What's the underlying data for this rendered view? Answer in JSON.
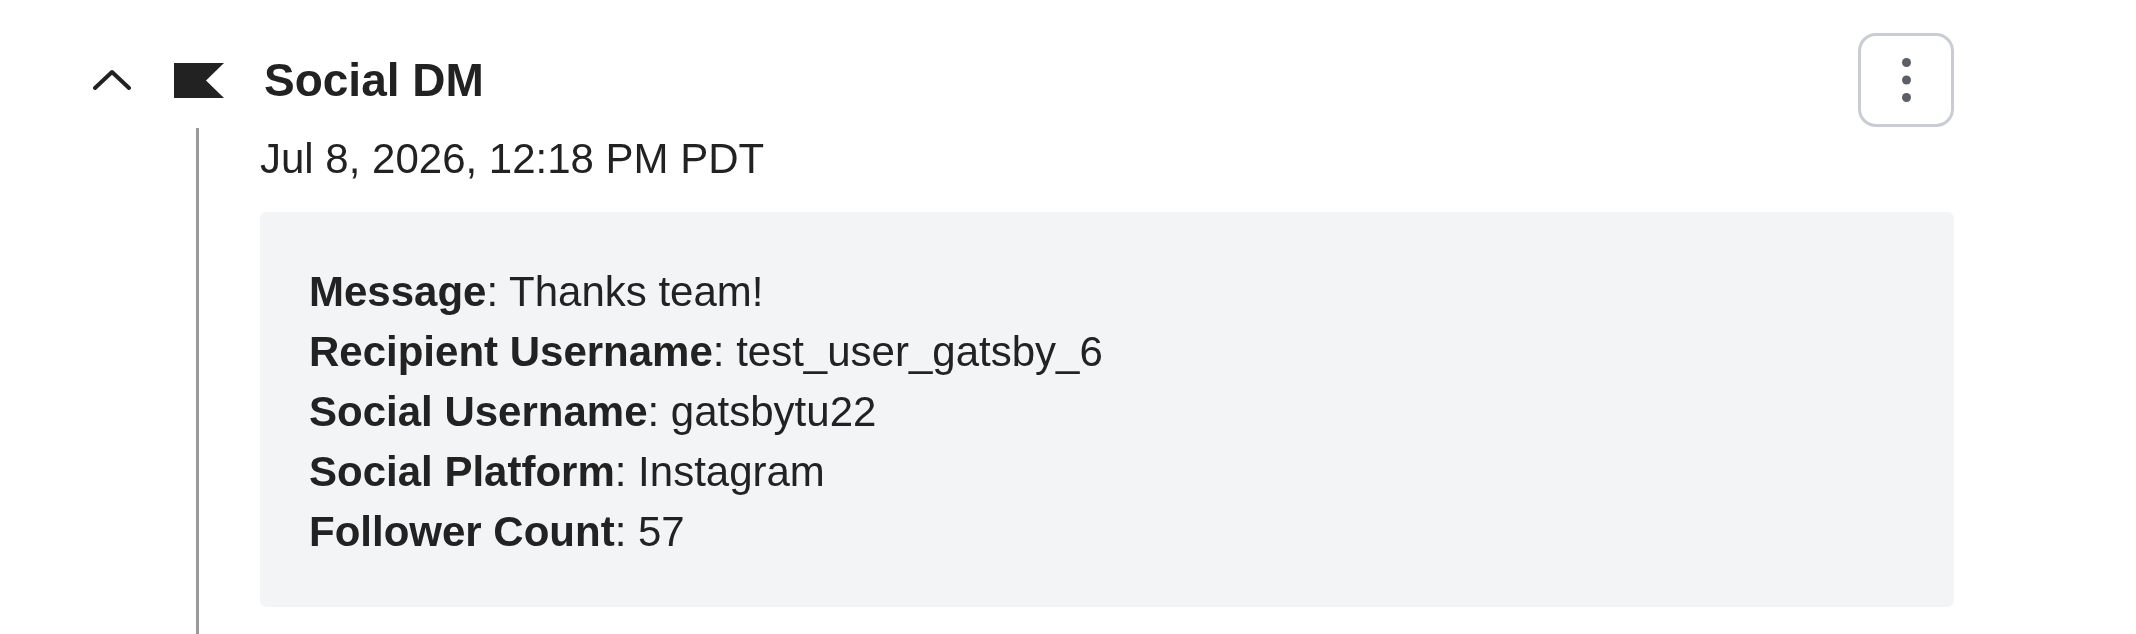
{
  "event": {
    "title": "Social DM",
    "expanded": true,
    "timestamp": "Jul 8, 2026, 12:18 PM PDT",
    "details": [
      "**Message**: Thanks team!",
      "**Recipient Username**: test_user_gatsby_6",
      "**Social Username**: gatsbytu22",
      "**Social Platform**: Instagram",
      "**Follower Count**: 57"
    ]
  }
}
